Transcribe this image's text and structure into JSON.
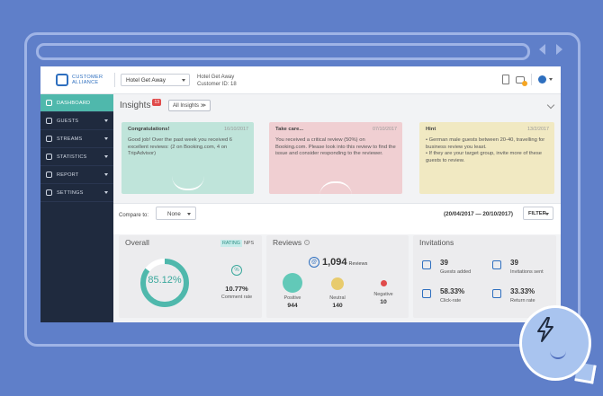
{
  "brand": {
    "line1": "CUSTOMER",
    "line2": "ALLIANCE"
  },
  "header": {
    "hotel_select": "Hotel Get Away",
    "hotel_name": "Hotel Get Away",
    "customer_id": "Customer ID: 18"
  },
  "sidebar": {
    "items": [
      {
        "label": "DASHBOARD",
        "icon": "dashboard-icon"
      },
      {
        "label": "GUESTS",
        "icon": "users-icon"
      },
      {
        "label": "STREAMS",
        "icon": "streams-icon"
      },
      {
        "label": "STATISTICS",
        "icon": "statistics-icon"
      },
      {
        "label": "REPORT",
        "icon": "report-icon"
      },
      {
        "label": "SETTINGS",
        "icon": "gear-icon"
      }
    ]
  },
  "insights": {
    "title": "Insights",
    "count": "13",
    "all_button": "All Insights",
    "cards": [
      {
        "title": "Congratulations!",
        "date": "16/10/2017",
        "body": "Good job! Over the past week you received 6 excellent reviews: (2 on Booking.com, 4 on TripAdvisor)"
      },
      {
        "title": "Take care...",
        "date": "07/10/2017",
        "body": "You received a critical review (50%) on Booking.com. Please look into this review to find the issue and consider responding to the reviewer."
      },
      {
        "title": "Hint",
        "date": "13/2/2017",
        "bullets": [
          "• German male guests between 20-40, travelling for business review you least.",
          "• If they are your target group, invite more of these guests to review."
        ]
      }
    ]
  },
  "filters": {
    "compare_label": "Compare to:",
    "compare_value": "None",
    "date_range": "(20/04/2017 — 20/10/2017)",
    "filter_button": "FILTER"
  },
  "overall": {
    "title": "Overall",
    "tab_rating": "RATING",
    "tab_nps": "NPS",
    "score": "85.12%",
    "score_value": 0.8512,
    "comment_rate": "10.77%",
    "comment_rate_label": "Comment rate"
  },
  "reviews": {
    "title": "Reviews",
    "total": "1,094",
    "total_label": "Reviews",
    "positive_label": "Positive",
    "positive_value": "944",
    "neutral_label": "Neutral",
    "neutral_value": "140",
    "negative_label": "Negative",
    "negative_value": "10"
  },
  "invitations": {
    "title": "Invitations",
    "guests_added": "39",
    "guests_added_label": "Guests added",
    "invitations_sent": "39",
    "invitations_sent_label": "Invitations sent",
    "click_rate": "58.33%",
    "click_rate_label": "Click-rate",
    "return_rate": "33.33%",
    "return_rate_label": "Return rate"
  },
  "colors": {
    "accent": "#4fb8ac",
    "sidebar": "#1f2a3e",
    "background": "#5f7fc9",
    "brand": "#2e6fbf"
  }
}
